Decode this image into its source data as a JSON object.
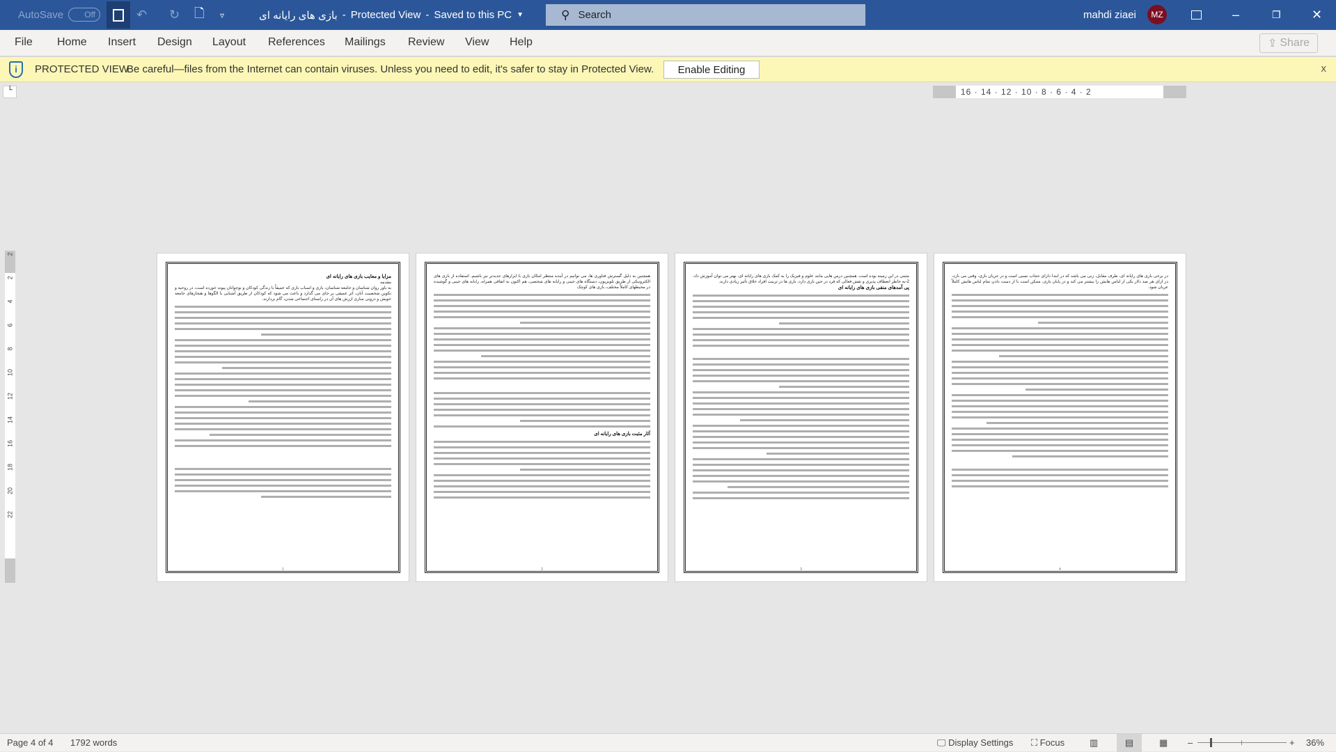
{
  "titlebar": {
    "autosave_label": "AutoSave",
    "autosave_state": "Off",
    "doc_title": "بازی های رایانه ای",
    "separator1": "-",
    "mode": "Protected View",
    "separator2": "-",
    "save_status": "Saved to this PC",
    "search_placeholder": "Search",
    "user_name": "mahdi ziaei",
    "user_initials": "MZ"
  },
  "ribbon": {
    "tabs": [
      "File",
      "Home",
      "Insert",
      "Design",
      "Layout",
      "References",
      "Mailings",
      "Review",
      "View",
      "Help"
    ],
    "share_label": "Share"
  },
  "protected_bar": {
    "label": "PROTECTED VIEW",
    "message": "Be careful—files from the Internet can contain viruses. Unless you need to edit, it's safer to stay in Protected View.",
    "enable_button": "Enable Editing",
    "close": "x"
  },
  "ruler": {
    "horizontal": "16 · 14 · 12 · 10 · 8 · 6 · 4 · 2",
    "vertical": [
      "2",
      "2",
      "4",
      "6",
      "8",
      "10",
      "12",
      "14",
      "16",
      "18",
      "20",
      "22"
    ]
  },
  "pages": [
    {
      "heading": "مزایا و معایب بازی های رایانه ای",
      "sub": "مقدمه",
      "text": "به باور روان شناسان و جامعه شناسان، بازی و اسباب بازی که عمیقاً با زندگی کودکان و نوجوانان پیوند خورده است، در روحیه و تکوین شخصیت آنان، اثر عمیقی بر جای می گذارد و باعث می شود که کودکان از طریق آشنایی با الگوها و هنجارهای جامعه خویش و درونی سازی ارزش های آن در راستای اجتماعی شدن، گام بردارند.",
      "number": "1"
    },
    {
      "heading": "",
      "sub": "",
      "text": "همچنین به دلیل گسترش فناوری ها، می توانیم در آینده منتظر امکان بازی با ابزارهای جدیدتر نیز باشیم. استفاده از بازی های الکترونیکی از طریق تلویزیون، دستگاه های جیبی و رایانه های شخصی، هم اکنون به اتفاقی همراه، رایانه های جیبی و گوشیده در محیطهای کاملاً مختلف، بازی های کوچک",
      "number": "2",
      "heading2": "آثار مثبت بازی های رایانه ای"
    },
    {
      "heading": "",
      "sub": "",
      "text": "مثبتی در این زمینه بوده است. همچنین درس هایی مانند علوم و فیزیک را به کمک بازی های رایانه ای، بهتر می توان آموزش داد. 2-به خاطر انعطاف پذیری و نقش فعالی که فرد در حین بازی دارد، بازی ها در تربیت افراد خلاق تأثیر زیادی دارند.",
      "number": "3",
      "heading2": "پی آمدهای منفی بازی های رایانه ای"
    },
    {
      "heading": "",
      "sub": "",
      "text": "در برخی بازی های رایانه ای، طرف مقابل، زنی می باشد که در ابتدا دارای حجاب نسبی است و در جریان بازی، وقتی می بازد، در ازای هر صد دلار یکی از لباس هایش را بیشتر می کند و در پایان بازی، ممکن است با از دست دادن تمام لباس هایش کاملاً عریان شود.",
      "number": "4"
    }
  ],
  "status": {
    "page": "Page 4 of 4",
    "words": "1792 words",
    "display_settings": "Display Settings",
    "focus": "Focus",
    "zoom": "36%",
    "zoom_level_percent": 36
  }
}
